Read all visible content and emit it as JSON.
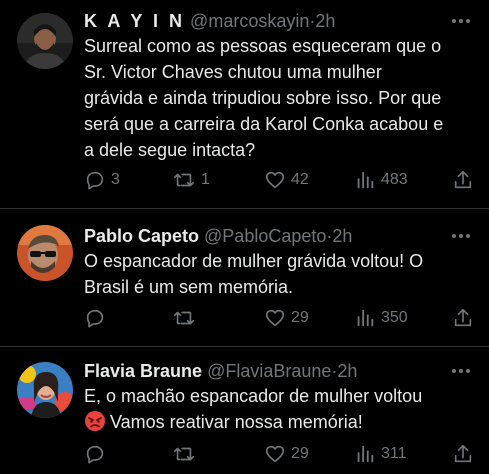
{
  "colors": {
    "background": "#000000",
    "text": "#e7e9ea",
    "secondary": "#71767b",
    "divider": "#2f3336"
  },
  "tweets": [
    {
      "name": "K A Y I N",
      "handle": "@marcoskayin",
      "dot": "·",
      "time": "2h",
      "lines": [
        "Surreal como as pessoas esqueceram que o",
        "Sr. Victor Chaves chutou uma mulher",
        "grávida e ainda tripudiou sobre isso. Por que",
        "será que a carreira da Karol Conka acabou e",
        "a dele segue intacta?"
      ],
      "replies": "3",
      "retweets": "1",
      "likes": "42",
      "views": "483",
      "icons": [
        "reply-icon",
        "retweet-icon",
        "like-icon",
        "views-icon",
        "share-icon"
      ]
    },
    {
      "name": "Pablo Capeto",
      "handle": "@PabloCapeto",
      "dot": "·",
      "time": "2h",
      "lines": [
        "O espancador de mulher grávida voltou! O",
        "Brasil é um sem memória."
      ],
      "replies": "",
      "retweets": "",
      "likes": "29",
      "views": "350",
      "icons": [
        "reply-icon",
        "retweet-icon",
        "like-icon",
        "views-icon",
        "share-icon"
      ]
    },
    {
      "name": "Flavia Braune",
      "handle": "@FlaviaBraune",
      "dot": "·",
      "time": "2h",
      "lines": [
        "E, o machão espancador de mulher voltou",
        "Vamos reativar nossa memória!"
      ],
      "emoji": "angry-face-emoji",
      "replies": "",
      "retweets": "",
      "likes": "29",
      "views": "311",
      "icons": [
        "reply-icon",
        "retweet-icon",
        "like-icon",
        "views-icon",
        "share-icon"
      ]
    }
  ]
}
